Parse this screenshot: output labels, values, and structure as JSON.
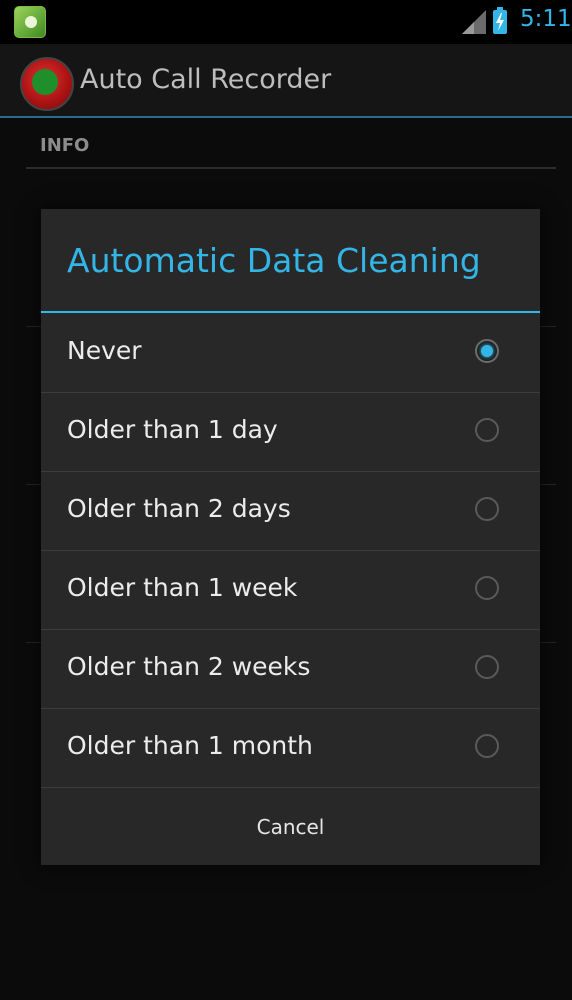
{
  "status_bar": {
    "time": "5:11",
    "notification_icon": "app-notification-icon",
    "signal_icon": "signal-icon",
    "battery_icon": "battery-charging-icon"
  },
  "action_bar": {
    "app_icon": "phone-recorder-icon",
    "title": "Auto Call Recorder"
  },
  "background": {
    "section_header": "INFO"
  },
  "dialog": {
    "title": "Automatic Data Cleaning",
    "options": [
      {
        "label": "Never",
        "selected": true
      },
      {
        "label": "Older than 1 day",
        "selected": false
      },
      {
        "label": "Older than 2 days",
        "selected": false
      },
      {
        "label": "Older than 1 week",
        "selected": false
      },
      {
        "label": "Older than 2 weeks",
        "selected": false
      },
      {
        "label": "Older than 1 month",
        "selected": false
      }
    ],
    "cancel_label": "Cancel"
  },
  "colors": {
    "accent": "#33b5e5",
    "dialog_bg": "#282828",
    "background": "#0b0b0b"
  }
}
